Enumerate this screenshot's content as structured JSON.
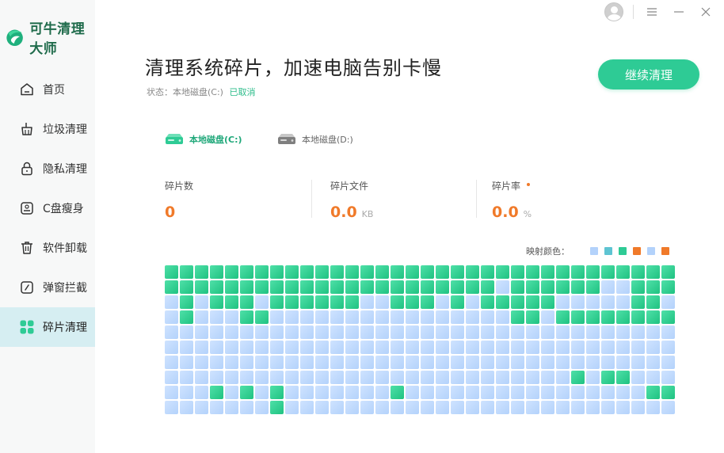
{
  "app": {
    "name": "可牛清理大师"
  },
  "sidebar": {
    "items": [
      {
        "label": "首页",
        "icon": "home-icon",
        "active": false
      },
      {
        "label": "垃圾清理",
        "icon": "broom-icon",
        "active": false
      },
      {
        "label": "隐私清理",
        "icon": "lock-icon",
        "active": false
      },
      {
        "label": "C盘瘦身",
        "icon": "disk-icon",
        "active": false
      },
      {
        "label": "软件卸载",
        "icon": "trash-icon",
        "active": false
      },
      {
        "label": "弹窗拦截",
        "icon": "popup-icon",
        "active": false
      },
      {
        "label": "碎片清理",
        "icon": "grid-icon",
        "active": true
      }
    ]
  },
  "window": {
    "buttons": [
      "menu-icon",
      "minimize-icon",
      "close-icon"
    ]
  },
  "main": {
    "title": "清理系统碎片，加速电脑告别卡慢",
    "status_label": "状态：本地磁盘(C:)",
    "status_value": "已取消",
    "cta_label": "继续清理",
    "drives": [
      {
        "label": "本地磁盘(C:)",
        "selected": true
      },
      {
        "label": "本地磁盘(D:)",
        "selected": false
      }
    ],
    "stats": [
      {
        "label": "碎片数",
        "value": "0",
        "unit": ""
      },
      {
        "label": "碎片文件",
        "value": "0.0",
        "unit": "KB"
      },
      {
        "label": "碎片率",
        "value": "0.0",
        "unit": "%"
      }
    ],
    "legend": {
      "label": "映射颜色：",
      "colors": [
        "#b3d2fb",
        "#5ec4d2",
        "#2ecb95",
        "#f07a2a",
        "#b3d2fb",
        "#f07a2a"
      ]
    }
  },
  "colors": {
    "accent": "#2ecb95",
    "orange": "#f07a2a",
    "empty": "#b3d2fb"
  },
  "disk_map": {
    "columns": 34,
    "rows": [
      "GGGGGGGGGGGGGGGGGGGGGGGGGGGGGGGGGG",
      "GGGGGGGGGGGGGGGGGGGGGGEGGGGGGEEGGG",
      "EGEGGGEGGGGGGEEGGGEGEGGGGGEEEEEGGE",
      "EGEEEGGEEEEEEEEEEEEEEEEGGEGGGGGGGGG",
      "EEEEEEEEEEEEEEEEEEEEEEEEEEEEEEEEEE",
      "EEEEEEEEEEEEEEEEEEEEEEEEEEEEEEEEEE",
      "EEEEEEEEEEEEEEEEEEEEEEEEEEEEEEEEEE",
      "EEEEEEEEEEEEEEEEEEEEEEEEEEEGEGGEEEEE",
      "EEEGEGEGEEEEEEEGEEEEEEEEEEEEEEEEGGEEE",
      "EEEEEEEGEEEEEEEEEEEEEEEEEEEEEEEEEE"
    ]
  }
}
